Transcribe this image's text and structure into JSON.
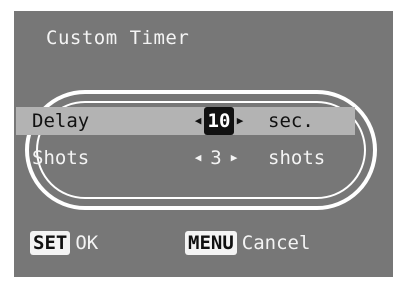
{
  "screen": {
    "title": "Custom Timer"
  },
  "menu": {
    "items": [
      {
        "label": "Delay",
        "value": "10",
        "unit": "sec.",
        "selected": true
      },
      {
        "label": "Shots",
        "value": "3",
        "unit": "shots",
        "selected": false
      }
    ],
    "arrow_left": "◀",
    "arrow_right": "▶"
  },
  "footer": {
    "set": {
      "key": "SET",
      "label": "OK"
    },
    "menu": {
      "key": "MENU",
      "label": "Cancel"
    }
  },
  "colors": {
    "screen_bg": "#777777",
    "selected_row_bg": "#b3b3b3",
    "text": "#f4f4f4"
  }
}
